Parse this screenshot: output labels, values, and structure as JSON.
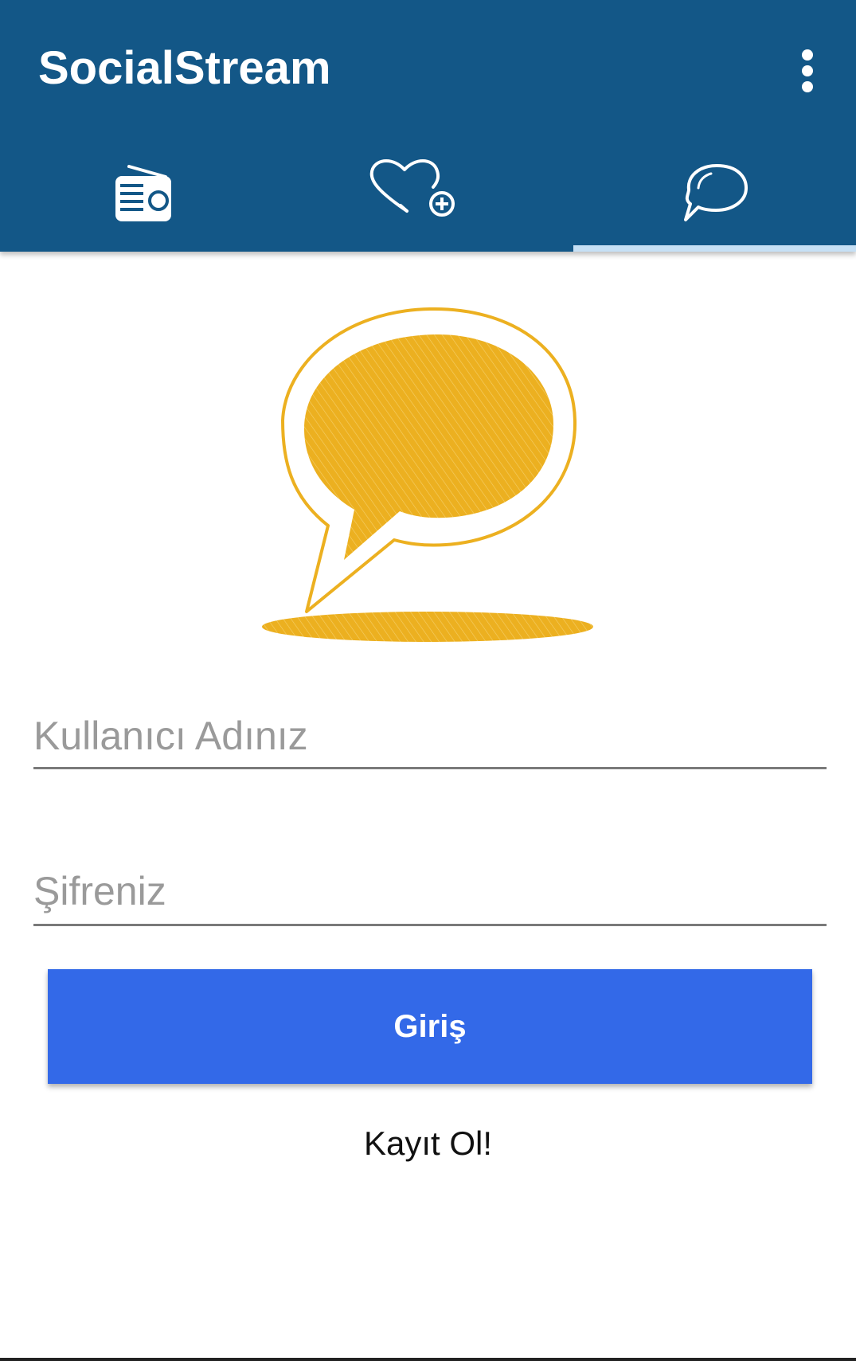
{
  "app": {
    "title": "SocialStream",
    "bar_color": "#135787"
  },
  "tabs": [
    {
      "name": "radio",
      "icon": "radio-icon",
      "selected": false
    },
    {
      "name": "favorites",
      "icon": "heart-plus-icon",
      "selected": false
    },
    {
      "name": "chat",
      "icon": "chat-bubble-icon",
      "selected": true
    }
  ],
  "logo": {
    "icon": "speech-bubble-logo",
    "color": "#ecb020"
  },
  "form": {
    "username_placeholder": "Kullanıcı Adınız",
    "password_placeholder": "Şifreniz",
    "login_label": "Giriş",
    "login_color": "#3369e8",
    "register_label": "Kayıt Ol!"
  }
}
